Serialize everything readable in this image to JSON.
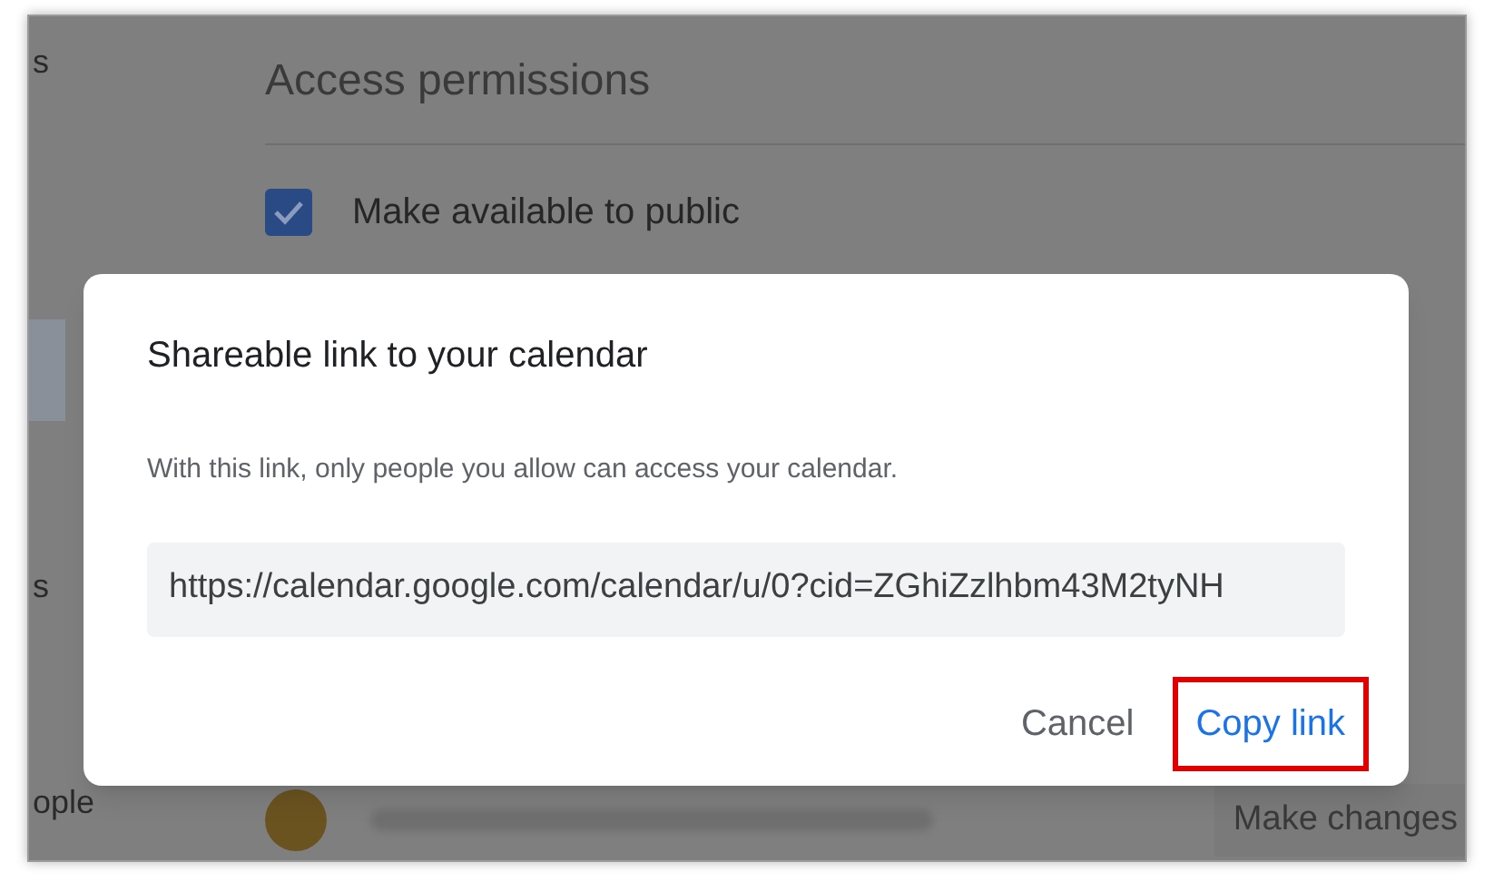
{
  "sidebar": {
    "items": [
      {
        "label": "s",
        "selected": false
      },
      {
        "label": "s",
        "selected": false
      },
      {
        "label": "ople",
        "selected": false
      }
    ]
  },
  "access_permissions": {
    "title": "Access permissions",
    "make_public": {
      "label": "Make available to public",
      "checked": true
    }
  },
  "shared_with": {
    "button": "Make changes"
  },
  "dialog": {
    "title": "Shareable link to your calendar",
    "description": "With this link, only people you allow can access your calendar.",
    "link": "https://calendar.google.com/calendar/u/0?cid=ZGhiZzlhbm43M2tyNH",
    "buttons": [
      {
        "label": "Cancel",
        "kind": "secondary",
        "highlighted": false
      },
      {
        "label": "Copy link",
        "kind": "primary",
        "highlighted": true
      }
    ]
  }
}
